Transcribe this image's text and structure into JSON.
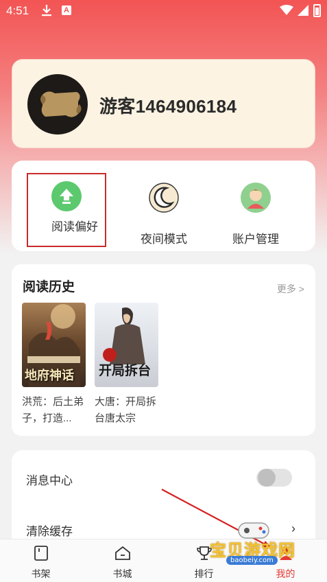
{
  "status_bar": {
    "time": "4:51",
    "download_icon": "download-icon",
    "app_icon": "A",
    "wifi_icon": "wifi-icon",
    "signal_icon": "signal-icon",
    "battery_icon": "battery-charging-icon"
  },
  "profile": {
    "username": "游客1464906184",
    "avatar_icon": "scroll-avatar-icon"
  },
  "quick_actions": [
    {
      "label": "阅读偏好",
      "icon": "upload-arrow-icon",
      "color": "#5cc96e",
      "selected": true
    },
    {
      "label": "夜间模式",
      "icon": "moon-icon",
      "color": "#f3e4c6",
      "selected": false
    },
    {
      "label": "账户管理",
      "icon": "user-avatar-icon",
      "color": "#8fd08f",
      "selected": false
    }
  ],
  "history": {
    "title": "阅读历史",
    "more_label": "更多 >",
    "books": [
      {
        "title": "洪荒：后土弟子，打造...",
        "cover_text": "地府神话"
      },
      {
        "title": "大唐：开局拆台唐太宗",
        "cover_text": "开局拆台"
      }
    ]
  },
  "settings": {
    "message_center_label": "消息中心",
    "message_center_enabled": false,
    "clear_cache_label": "清除缓存"
  },
  "bottom_nav": [
    {
      "label": "书架",
      "icon": "bookshelf-icon",
      "active": false
    },
    {
      "label": "书城",
      "icon": "bookstore-icon",
      "active": false
    },
    {
      "label": "排行",
      "icon": "trophy-icon",
      "active": false
    },
    {
      "label": "我的",
      "icon": "profile-icon",
      "active": true
    }
  ],
  "watermark": {
    "text": "宝贝游戏网",
    "url": "baobeiy.com"
  },
  "colors": {
    "accent": "#e53935",
    "hero_top": "#f35454",
    "selection_box": "#c92a2a"
  }
}
